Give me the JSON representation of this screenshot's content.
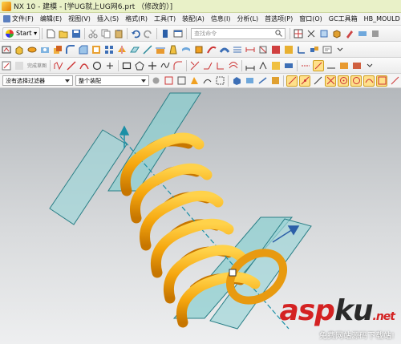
{
  "window": {
    "title": "NX 10 - 建模 - [学UG就上UG网6.prt （修改的）]"
  },
  "menubar": {
    "items": [
      "文件(F)",
      "编辑(E)",
      "视图(V)",
      "插入(S)",
      "格式(R)",
      "工具(T)",
      "装配(A)",
      "信息(I)",
      "分析(L)",
      "首选项(P)",
      "窗口(O)",
      "GC工具箱",
      "HB_MOULD 帮"
    ]
  },
  "toolbar1": {
    "start_label": "Start ▾",
    "command_search_placeholder": "查找命令"
  },
  "toolbar2": {
    "inactive_label": "完成草图"
  },
  "filterbar": {
    "selection_filter_value": "没有选择过滤器",
    "assembly_scope_value": "整个装配"
  },
  "watermark": {
    "brand_asp": "asp",
    "brand_ku": "ku",
    "brand_net": ".net",
    "subtitle": "免费网站源码下载站!"
  },
  "colors": {
    "spring": "#f6a70e",
    "plane": "#8ecfd0",
    "axis": "#1a8fa6",
    "title_bar": "#e9f1c8"
  },
  "icons": [
    "app-logo-icon",
    "new-file-icon",
    "open-icon",
    "save-icon",
    "cut-icon",
    "copy-icon",
    "paste-icon",
    "undo-icon",
    "redo-icon",
    "search-icon",
    "sketch-icon",
    "extrude-icon",
    "revolve-icon",
    "line-icon",
    "arc-icon",
    "circle-icon",
    "rectangle-icon",
    "fillet-icon",
    "snap-icon"
  ]
}
